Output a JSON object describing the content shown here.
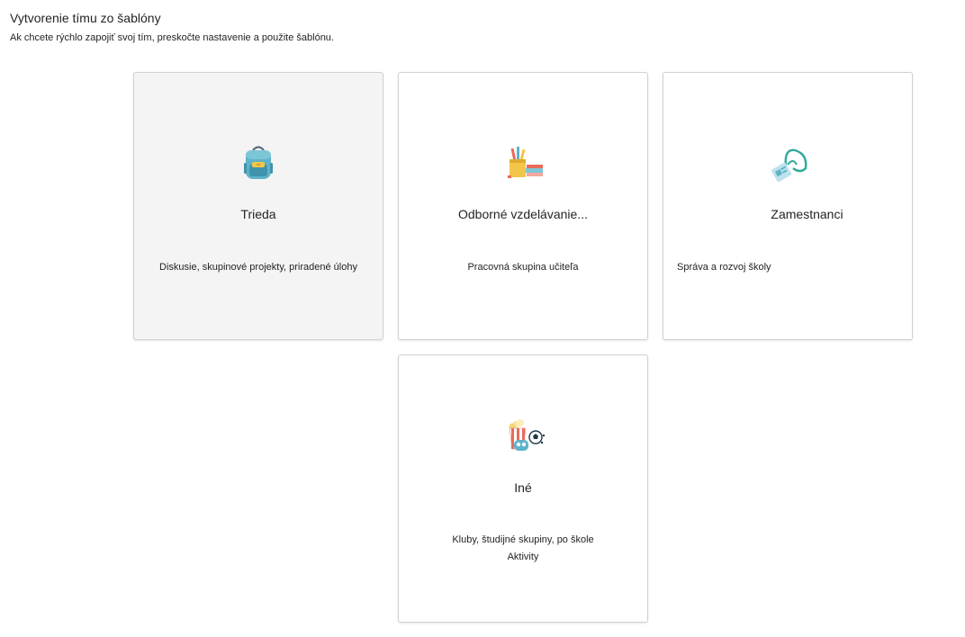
{
  "header": {
    "title": "Vytvorenie tímu zo šablóny",
    "subtitle": "Ak chcete rýchlo zapojiť svoj tím, preskočte nastavenie a použite šablónu."
  },
  "templates": [
    {
      "name": "Trieda",
      "description": "Diskusie, skupinové projekty, priradené úlohy",
      "icon": "backpack-icon"
    },
    {
      "name": "Odborné vzdelávanie...",
      "description": "Pracovná skupina učiteľa",
      "icon": "books-pencils-icon"
    },
    {
      "name": "Zamestnanci",
      "description": "Správa a rozvoj školy",
      "icon": "id-badge-lanyard-icon"
    },
    {
      "name": "Iné",
      "description_line1": "Kluby, študijné skupiny, po škole",
      "description_line2": "Aktivity",
      "icon": "popcorn-soccer-icon"
    }
  ],
  "colors": {
    "card_border": "#d1d1d1",
    "card_hover_bg": "#f4f4f4",
    "text": "#242424"
  }
}
